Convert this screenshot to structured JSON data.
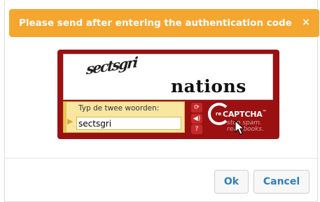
{
  "dialog": {
    "title": "Please send after entering the authentication code",
    "close_glyph": "×"
  },
  "captcha": {
    "image_words": [
      "sectsgri",
      "nations"
    ],
    "instruction": "Typ de twee woorden:",
    "answer_value": "sectsgri",
    "brand": "reCAPTCHA",
    "brand_prefix": "re",
    "brand_name": "CAPTCHA",
    "trademark": "™",
    "tagline_1": "stop spam.",
    "tagline_2": "read books.",
    "icons": [
      "refresh-icon",
      "audio-icon",
      "help-icon"
    ]
  },
  "buttons": {
    "ok_label": "Ok",
    "cancel_label": "Cancel"
  },
  "colors": {
    "header_bg": "#f5a62f",
    "captcha_bg": "#9b1111",
    "button_text": "#2f7fbd",
    "input_panel": "#f9e6a0"
  }
}
